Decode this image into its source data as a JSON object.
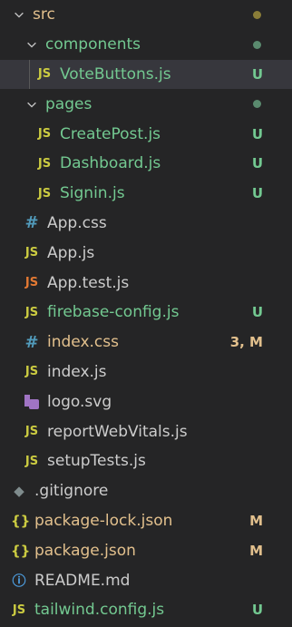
{
  "explorer": {
    "src": {
      "label": "src"
    },
    "components": {
      "label": "components"
    },
    "vote_buttons": {
      "icon": "JS",
      "label": "VoteButtons.js",
      "badge": "U"
    },
    "pages": {
      "label": "pages"
    },
    "create_post": {
      "icon": "JS",
      "label": "CreatePost.js",
      "badge": "U"
    },
    "dashboard": {
      "icon": "JS",
      "label": "Dashboard.js",
      "badge": "U"
    },
    "signin": {
      "icon": "JS",
      "label": "Signin.js",
      "badge": "U"
    },
    "app_css": {
      "icon": "#",
      "label": "App.css"
    },
    "app_js": {
      "icon": "JS",
      "label": "App.js"
    },
    "app_test": {
      "icon": "JS",
      "label": "App.test.js"
    },
    "firebase_config": {
      "icon": "JS",
      "label": "firebase-config.js",
      "badge": "U"
    },
    "index_css": {
      "icon": "#",
      "label": "index.css",
      "badge": "3, M"
    },
    "index_js": {
      "icon": "JS",
      "label": "index.js"
    },
    "logo_svg": {
      "label": "logo.svg"
    },
    "report_web_vitals": {
      "icon": "JS",
      "label": "reportWebVitals.js"
    },
    "setup_tests": {
      "icon": "JS",
      "label": "setupTests.js"
    },
    "gitignore": {
      "icon": "◆",
      "label": ".gitignore"
    },
    "package_lock": {
      "icon": "{}",
      "label": "package-lock.json",
      "badge": "M"
    },
    "package_json": {
      "icon": "{}",
      "label": "package.json",
      "badge": "M"
    },
    "readme": {
      "icon": "ⓘ",
      "label": "README.md"
    },
    "tailwind_config": {
      "icon": "JS",
      "label": "tailwind.config.js",
      "badge": "U"
    }
  },
  "colors": {
    "background": "#252526",
    "selected_row": "#37373d",
    "untracked_green": "#73c991",
    "modified_yellow": "#e2c08d",
    "js_icon": "#cbcb41",
    "css_icon": "#519aba",
    "test_icon": "#e37933"
  }
}
